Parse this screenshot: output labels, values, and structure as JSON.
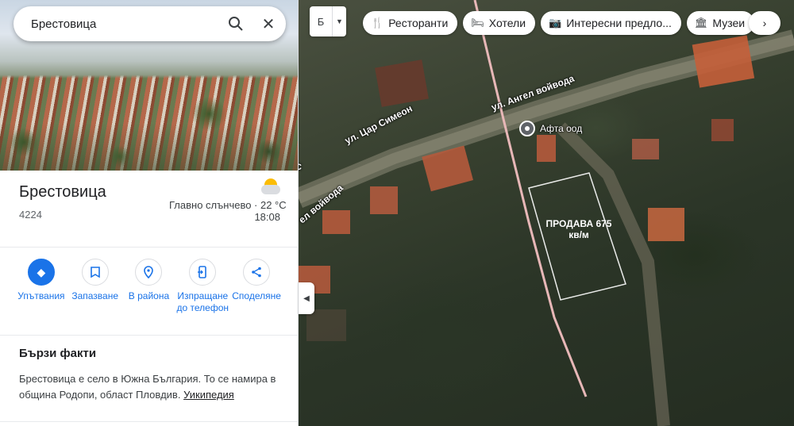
{
  "search": {
    "query": "Брестовица"
  },
  "place": {
    "name": "Брестовица",
    "postal_code": "4224",
    "weather_text": "Главно слънчево · 22 °C",
    "weather_time": "18:08"
  },
  "actions": [
    {
      "label": "Упътвания",
      "icon": "directions-icon"
    },
    {
      "label": "Запазване",
      "icon": "bookmark-icon"
    },
    {
      "label": "В района",
      "icon": "nearby-icon"
    },
    {
      "label": "Изпращане до телефон",
      "icon": "send-to-phone-icon"
    },
    {
      "label": "Споделяне",
      "icon": "share-icon"
    }
  ],
  "quick_facts": {
    "title": "Бързи факти",
    "text": "Брестовица е село в Южна България. То се намира в община Родопи, област Пловдив.",
    "link": "Уикипедия"
  },
  "map": {
    "layer_glyph": "Б",
    "chips": [
      {
        "label": "Ресторанти",
        "icon": "restaurant-icon"
      },
      {
        "label": "Хотели",
        "icon": "hotel-icon"
      },
      {
        "label": "Интересни предло...",
        "icon": "camera-icon"
      },
      {
        "label": "Музеи",
        "icon": "museum-icon"
      }
    ],
    "street_labels": [
      "ул. Ангел войвода",
      "ул. Цар Симеон",
      "ел войвода",
      "C"
    ],
    "poi": "Афта оод",
    "sale_text": "ПРОДАВА 675 кв/м"
  },
  "colors": {
    "accent": "#1a73e8",
    "road_line": "#e7b7b7"
  }
}
